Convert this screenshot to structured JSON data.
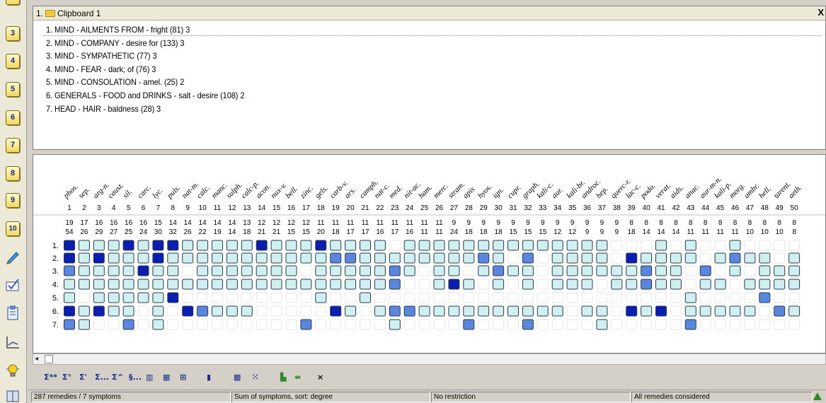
{
  "left_toolbar": {
    "tabs": [
      "3",
      "4",
      "5",
      "6",
      "7",
      "8",
      "9",
      "10"
    ],
    "icons": [
      "pencil-icon",
      "check-icon",
      "clipboard-icon",
      "chart-icon",
      "lightbulb-icon",
      "book-icon"
    ]
  },
  "clipboard": {
    "index": "1.",
    "title": "Clipboard 1",
    "close": "X",
    "symptoms": [
      "1. MIND - AILMENTS FROM - fright (81) 3",
      "2. MIND - COMPANY - desire for (133) 3",
      "3. MIND - SYMPATHETIC (77) 3",
      "4. MIND - FEAR - dark; of (76) 3",
      "5. MIND - CONSOLATION - amel. (25) 2",
      "6. GENERALS - FOOD and DRINKS - salt - desire (108) 2",
      "7. HEAD - HAIR - baldness (28) 3"
    ]
  },
  "grid": {
    "remedies": [
      "phos.",
      "sep.",
      "arg-n.",
      "caust.",
      "sil.",
      "carc.",
      "lyc.",
      "puls.",
      "nat-m.",
      "calc.",
      "manc.",
      "sulph.",
      "calc-p.",
      "acon.",
      "nux-v.",
      "bell.",
      "zinc.",
      "gels.",
      "carb-v.",
      "ars.",
      "camph.",
      "nat-c.",
      "med.",
      "nit-ac.",
      "ham.",
      "merc.",
      "stram.",
      "apis",
      "hyos.",
      "ign.",
      "cupr.",
      "graph.",
      "kali-c.",
      "aur.",
      "kali-br.",
      "androc.",
      "hep.",
      "querc-r.",
      "lac-c.",
      "podo.",
      "verat.",
      "aids.",
      "anac.",
      "aur-m-n.",
      "kali-p.",
      "morg.",
      "ambr.",
      "hell.",
      "tarent.",
      "aeth."
    ],
    "numbers": [
      "1",
      "2",
      "3",
      "4",
      "5",
      "6",
      "7",
      "8",
      "9",
      "10",
      "11",
      "12",
      "13",
      "14",
      "15",
      "16",
      "17",
      "18",
      "19",
      "20",
      "21",
      "22",
      "23",
      "24",
      "25",
      "26",
      "27",
      "28",
      "29",
      "30",
      "31",
      "32",
      "33",
      "34",
      "35",
      "36",
      "37",
      "38",
      "39",
      "40",
      "41",
      "42",
      "43",
      "44",
      "45",
      "46",
      "47",
      "48",
      "49",
      "50"
    ],
    "symptom_counts": [
      "19",
      "17",
      "16",
      "16",
      "16",
      "16",
      "15",
      "14",
      "14",
      "14",
      "14",
      "14",
      "13",
      "12",
      "12",
      "12",
      "12",
      "11",
      "11",
      "11",
      "11",
      "11",
      "11",
      "11",
      "11",
      "11",
      "9",
      "9",
      "9",
      "9",
      "9",
      "9",
      "9",
      "9",
      "9",
      "9",
      "9",
      "9",
      "8",
      "8",
      "8",
      "8",
      "8",
      "8",
      "8",
      "8",
      "8",
      "8",
      "8",
      "8"
    ],
    "degree_sums": [
      "54",
      "26",
      "29",
      "27",
      "25",
      "24",
      "30",
      "32",
      "26",
      "22",
      "19",
      "14",
      "18",
      "21",
      "21",
      "15",
      "15",
      "20",
      "18",
      "17",
      "17",
      "16",
      "17",
      "16",
      "11",
      "11",
      "24",
      "18",
      "18",
      "18",
      "15",
      "15",
      "15",
      "12",
      "12",
      "9",
      "9",
      "9",
      "18",
      "14",
      "14",
      "14",
      "11",
      "11",
      "11",
      "11",
      "10",
      "10",
      "10",
      "8"
    ],
    "row_labels": [
      "1.",
      "2.",
      "3.",
      "4.",
      "5.",
      "6.",
      "7."
    ],
    "cells": [
      [
        3,
        1,
        1,
        1,
        3,
        1,
        3,
        3,
        1,
        1,
        1,
        1,
        1,
        3,
        1,
        1,
        1,
        3,
        1,
        1,
        1,
        1,
        0,
        1,
        1,
        1,
        1,
        1,
        1,
        1,
        1,
        1,
        1,
        1,
        1,
        1,
        1,
        0,
        0,
        0,
        1,
        0,
        1,
        0,
        0,
        1,
        0,
        0,
        0,
        0
      ],
      [
        3,
        1,
        3,
        1,
        1,
        1,
        3,
        1,
        1,
        1,
        1,
        1,
        1,
        1,
        1,
        1,
        1,
        1,
        2,
        2,
        1,
        1,
        1,
        1,
        1,
        1,
        1,
        1,
        2,
        1,
        0,
        2,
        0,
        1,
        1,
        1,
        1,
        0,
        3,
        1,
        1,
        1,
        1,
        0,
        1,
        2,
        1,
        1,
        0,
        1
      ],
      [
        2,
        1,
        1,
        1,
        1,
        3,
        1,
        1,
        0,
        1,
        1,
        1,
        1,
        1,
        1,
        1,
        0,
        1,
        1,
        1,
        1,
        1,
        2,
        1,
        0,
        1,
        1,
        0,
        1,
        2,
        1,
        1,
        0,
        1,
        1,
        1,
        1,
        1,
        1,
        2,
        1,
        1,
        0,
        2,
        0,
        1,
        0,
        1,
        1,
        1
      ],
      [
        1,
        1,
        1,
        1,
        1,
        1,
        1,
        1,
        1,
        1,
        1,
        1,
        1,
        1,
        1,
        1,
        1,
        1,
        1,
        1,
        1,
        1,
        2,
        0,
        0,
        1,
        3,
        1,
        0,
        1,
        0,
        1,
        0,
        1,
        1,
        1,
        0,
        1,
        1,
        2,
        1,
        1,
        0,
        1,
        1,
        0,
        1,
        1,
        1,
        1
      ],
      [
        1,
        0,
        1,
        1,
        1,
        1,
        1,
        3,
        0,
        0,
        0,
        0,
        0,
        0,
        0,
        0,
        0,
        1,
        0,
        0,
        1,
        0,
        0,
        0,
        0,
        0,
        0,
        0,
        0,
        0,
        0,
        0,
        0,
        0,
        0,
        0,
        0,
        0,
        0,
        0,
        0,
        0,
        1,
        0,
        0,
        0,
        0,
        2,
        0,
        0
      ],
      [
        3,
        1,
        3,
        1,
        1,
        0,
        1,
        0,
        3,
        2,
        1,
        1,
        1,
        0,
        0,
        0,
        0,
        0,
        3,
        1,
        0,
        1,
        2,
        2,
        1,
        1,
        1,
        1,
        1,
        1,
        1,
        1,
        1,
        1,
        0,
        1,
        1,
        0,
        3,
        1,
        3,
        0,
        1,
        1,
        1,
        1,
        1,
        0,
        2,
        1
      ],
      [
        2,
        1,
        0,
        0,
        2,
        0,
        1,
        0,
        0,
        0,
        0,
        0,
        0,
        0,
        0,
        0,
        2,
        0,
        0,
        0,
        0,
        0,
        1,
        0,
        0,
        0,
        0,
        2,
        0,
        0,
        0,
        2,
        0,
        0,
        0,
        0,
        1,
        0,
        0,
        0,
        0,
        0,
        2,
        0,
        0,
        0,
        0,
        0,
        0,
        0
      ]
    ]
  },
  "bottom_toolbar": {
    "buttons": [
      "Σ**",
      "Σ°",
      "Σ'",
      "Σ...",
      "Σ^",
      "§...",
      "▥",
      "▦",
      "⊞",
      "▮",
      "▩",
      "⁙",
      "▙",
      "⇴",
      "×"
    ]
  },
  "status": {
    "count": "287 remedies / 7 symptoms",
    "sort": "Sum of symptoms, sort: degree",
    "restriction": "No restriction",
    "considered": "All remedies considered"
  },
  "colors": {
    "empty": "#ffffff",
    "degree1": "#cfeff1",
    "degree2": "#5b86e0",
    "degree3": "#0a1fb2",
    "border": "#2a3a4a"
  }
}
